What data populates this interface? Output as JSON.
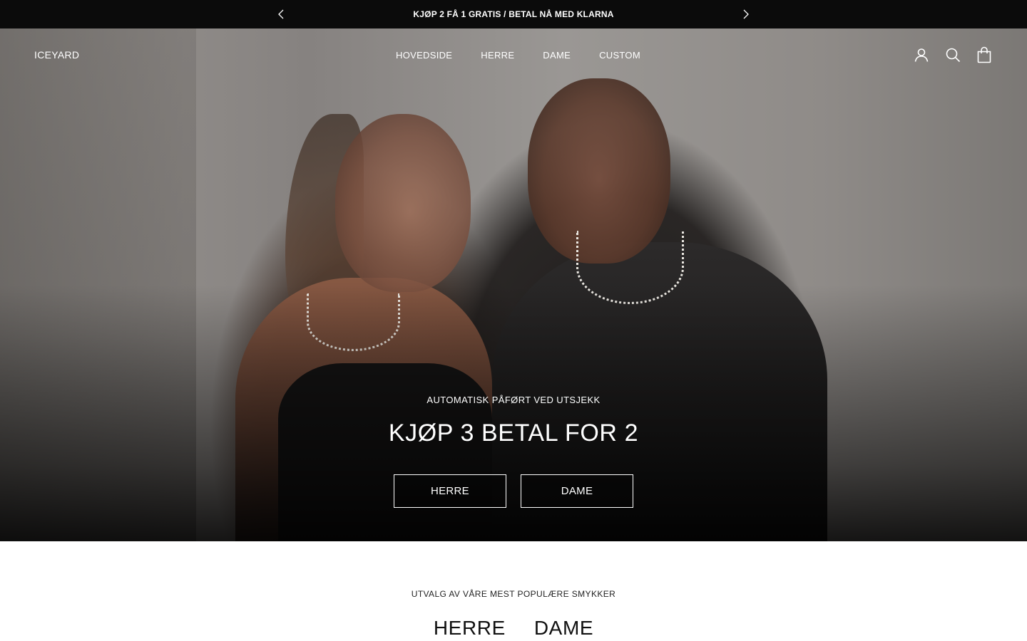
{
  "announcement": {
    "message": "KJØP 2 FÅ 1 GRATIS / BETAL NÅ MED KLARNA",
    "prev_icon": "chevron-left-icon",
    "next_icon": "chevron-right-icon"
  },
  "header": {
    "logo": "ICEYARD",
    "nav": [
      "HOVEDSIDE",
      "HERRE",
      "DAME",
      "CUSTOM"
    ],
    "icons": [
      "account-icon",
      "search-icon",
      "cart-icon"
    ]
  },
  "hero": {
    "eyebrow": "AUTOMATISK PÅFØRT VED UTSJEKK",
    "headline": "KJØP 3 BETAL FOR 2",
    "buttons": [
      "HERRE",
      "DAME"
    ]
  },
  "featured": {
    "subtitle": "UTVALG AV VÅRE MEST POPULÆRE SMYKKER",
    "tabs": [
      "HERRE",
      "DAME"
    ]
  },
  "colors": {
    "announcement_bg": "#0b0b0b",
    "text_light": "#ffffff",
    "text_dark": "#1a1a1a"
  }
}
